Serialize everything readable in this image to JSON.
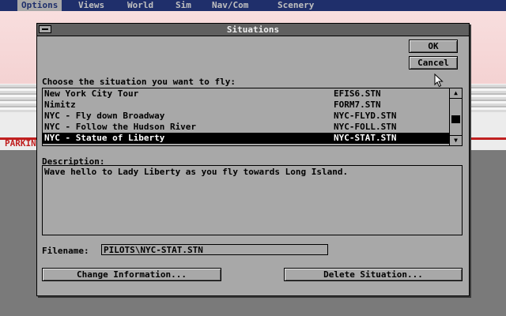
{
  "menu": [
    {
      "label": "Options",
      "active": true
    },
    {
      "label": "Views"
    },
    {
      "label": "World"
    },
    {
      "label": "Sim"
    },
    {
      "label": "Nav/Com"
    },
    {
      "label": "Scenery"
    }
  ],
  "background": {
    "parking_label": "PARKIN"
  },
  "dialog": {
    "title": "Situations",
    "ok_label": "OK",
    "cancel_label": "Cancel",
    "choose_label": "Choose the situation you want to fly:",
    "situations": [
      {
        "name": "New York City Tour",
        "file": "EFIS6.STN"
      },
      {
        "name": "Nimitz",
        "file": "FORM7.STN"
      },
      {
        "name": "NYC - Fly down Broadway",
        "file": "NYC-FLYD.STN"
      },
      {
        "name": "NYC - Follow the Hudson River",
        "file": "NYC-FOLL.STN"
      },
      {
        "name": "NYC - Statue of Liberty",
        "file": "NYC-STAT.STN",
        "selected": true
      }
    ],
    "description_label": "Description:",
    "description": "Wave hello to Lady Liberty as you fly towards Long Island.",
    "filename_label": "Filename:",
    "filename_value": "PILOTS\\NYC-STAT.STN",
    "change_info_label": "Change Information...",
    "delete_label": "Delete Situation..."
  },
  "colors": {
    "menubar": "#1f2f6b",
    "dialog_bg": "#a8a8a8",
    "titlebar": "#606060",
    "selection": "#000000"
  },
  "icons": [
    "system-menu-icon",
    "scroll-up-arrow-icon",
    "scroll-down-arrow-icon",
    "mouse-pointer-icon"
  ]
}
